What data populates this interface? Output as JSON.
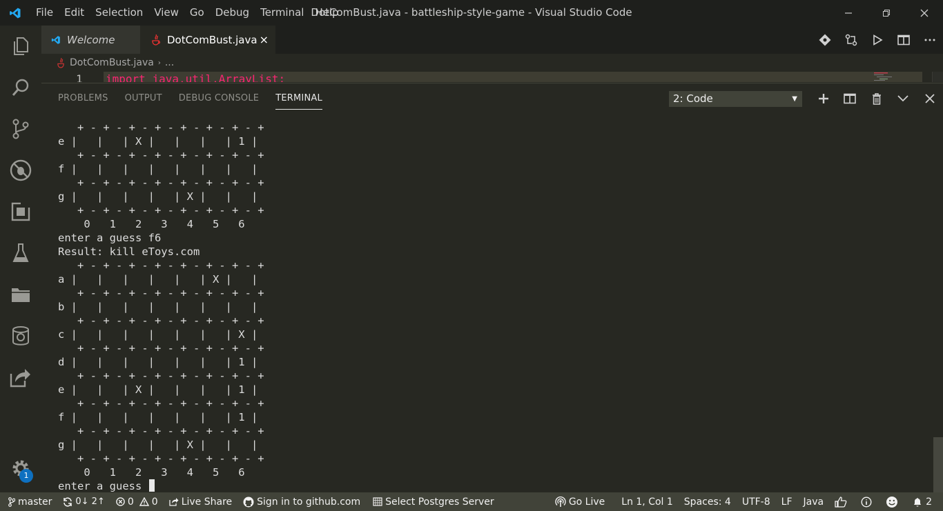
{
  "window": {
    "title": "DotComBust.java - battleship-style-game - Visual Studio Code",
    "menu": [
      "File",
      "Edit",
      "Selection",
      "View",
      "Go",
      "Debug",
      "Terminal",
      "Help"
    ]
  },
  "tabs": [
    {
      "label": "Welcome",
      "active": false
    },
    {
      "label": "DotComBust.java",
      "active": true,
      "close": "×"
    }
  ],
  "breadcrumb": {
    "file": "DotComBust.java",
    "sep": "›",
    "more": "..."
  },
  "editor": {
    "line_number": "1",
    "code": "import java.util.ArrayList;"
  },
  "panel": {
    "tabs": [
      "PROBLEMS",
      "OUTPUT",
      "DEBUG CONSOLE",
      "TERMINAL"
    ],
    "active_tab": "TERMINAL",
    "terminal_select": "2: Code"
  },
  "terminal": {
    "lines": [
      "   + - + - + - + - + - + - + - +",
      "e |   |   | X |   |   |   | 1 |",
      "   + - + - + - + - + - + - + - +",
      "f |   |   |   |   |   |   |   |",
      "   + - + - + - + - + - + - + - +",
      "g |   |   |   |   | X |   |   |",
      "   + - + - + - + - + - + - + - +",
      "    0   1   2   3   4   5   6",
      "enter a guess f6",
      "Result: kill eToys.com",
      "   + - + - + - + - + - + - + - +",
      "a |   |   |   |   |   | X |   |",
      "   + - + - + - + - + - + - + - +",
      "b |   |   |   |   |   |   |   |",
      "   + - + - + - + - + - + - + - +",
      "c |   |   |   |   |   |   | X |",
      "   + - + - + - + - + - + - + - +",
      "d |   |   |   |   |   |   | 1 |",
      "   + - + - + - + - + - + - + - +",
      "e |   |   | X |   |   |   | 1 |",
      "   + - + - + - + - + - + - + - +",
      "f |   |   |   |   |   |   | 1 |",
      "   + - + - + - + - + - + - + - +",
      "g |   |   |   |   | X |   |   |",
      "   + - + - + - + - + - + - + - +",
      "    0   1   2   3   4   5   6"
    ],
    "prompt": "enter a guess "
  },
  "activity": {
    "manage_badge": "1"
  },
  "status": {
    "branch": "master",
    "sync": "0↓ 2↑",
    "errors": "0",
    "warnings": "0",
    "live_share": "Live Share",
    "github": "Sign in to github.com",
    "postgres": "Select Postgres Server",
    "go_live": "Go Live",
    "position": "Ln 1, Col 1",
    "spaces": "Spaces: 4",
    "encoding": "UTF-8",
    "eol": "LF",
    "language": "Java",
    "notifications": "2"
  },
  "colors": {
    "accent_blue": "#23a9f2",
    "keyword_pink": "#f92672",
    "badge_blue": "#0e70c0",
    "statusbar": "#414339"
  }
}
